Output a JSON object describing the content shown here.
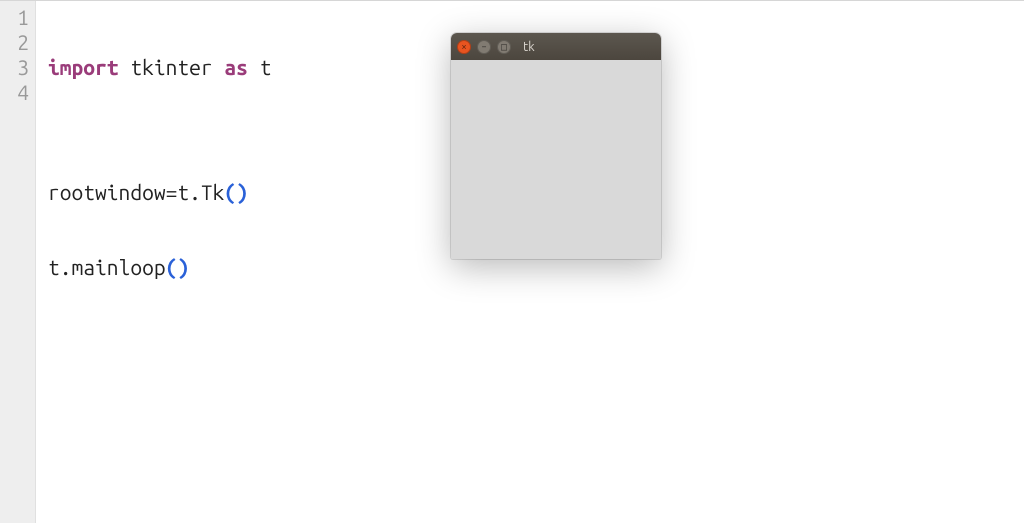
{
  "editor": {
    "line_numbers": [
      "1",
      "2",
      "3",
      "4"
    ],
    "code": {
      "l1": {
        "import_kw": "import",
        "module": " tkinter ",
        "as_kw": "as",
        "alias": " t"
      },
      "l2": "",
      "l3": {
        "pre": "rootwindow=t",
        "dot": ".",
        "cls": "Tk",
        "lp": "(",
        "rp": ")"
      },
      "l4": {
        "pre": "t",
        "dot": ".",
        "fn": "mainloop",
        "lp": "(",
        "rp": ")"
      }
    }
  },
  "tk_window": {
    "title": "tk",
    "controls": {
      "close_glyph": "×",
      "min_glyph": "–",
      "max_glyph": "□"
    }
  }
}
